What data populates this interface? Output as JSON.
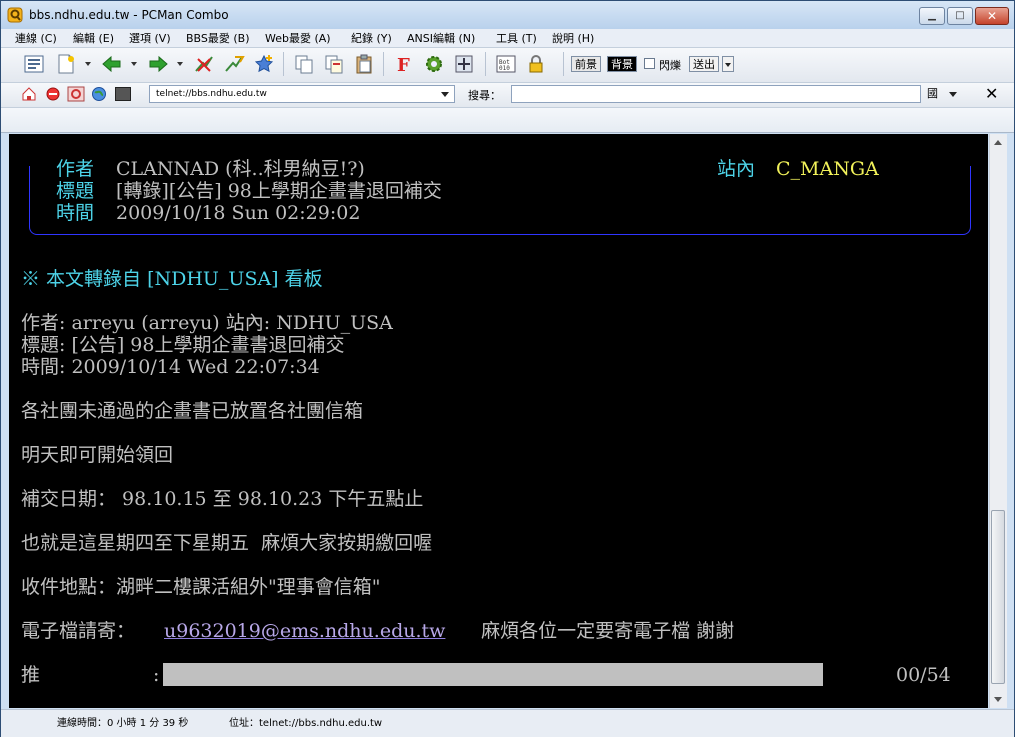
{
  "window": {
    "title": "bbs.ndhu.edu.tw - PCMan Combo",
    "minimize": "▁",
    "maximize": "□",
    "close": "✕"
  },
  "menu": [
    "連線 (C)",
    "編輯 (E)",
    "選項 (V)",
    "BBS最愛 (B)",
    "Web最愛 (A)",
    "紀錄 (Y)",
    "ANSI編輯 (N)",
    "工具 (T)",
    "說明 (H)"
  ],
  "toolbar": {
    "fg_label": "前景",
    "bg_label": "背景",
    "blink_label": "閃爍",
    "send_label": "送出"
  },
  "address": {
    "url": "telnet://bbs.ndhu.edu.tw",
    "search_label": "搜尋：",
    "search_value": "",
    "lang": "國"
  },
  "colors": {
    "header_label": "#4dd3e8",
    "board_name": "#f2f25a",
    "box_border": "#2f35ff",
    "link": "#b8a8e8",
    "text": "#c0c0c0"
  },
  "article": {
    "header": {
      "author_label": "作者",
      "author": "CLANNAD (科..科男納豆!?)",
      "board_label": "站內",
      "board": "C_MANGA",
      "title_label": "標題",
      "title": "[轉錄][公告] 98上學期企畫書退回補交",
      "time_label": "時間",
      "time": "2009/10/18 Sun 02:29:02"
    },
    "repost_note": "※ 本文轉錄自 [NDHU_USA] 看板",
    "orig_author": "作者: arreyu (arreyu) 站內: NDHU_USA",
    "orig_title": "標題: [公告] 98上學期企畫書退回補交",
    "orig_time": "時間: 2009/10/14 Wed 22:07:34",
    "line1": "各社團未通過的企畫書已放置各社團信箱",
    "line2": "明天即可開始領回",
    "line3": "補交日期： 98.10.15 至 98.10.23 下午五點止",
    "line4": "也就是這星期四至下星期五  麻煩大家按期繳回喔",
    "line5": "收件地點：湖畔二樓課活組外\"理事會信箱\"",
    "email_prefix": "電子檔請寄：",
    "email": "u9632019@ems.ndhu.edu.tw",
    "email_suffix": "  麻煩各位一定要寄電子檔 謝謝",
    "push_label": "推",
    "push_colon": ":",
    "push_count": "00/54"
  },
  "status": {
    "conn_time": "連線時間：0 小時 1 分 39 秒",
    "address": "位址：telnet://bbs.ndhu.edu.tw"
  }
}
